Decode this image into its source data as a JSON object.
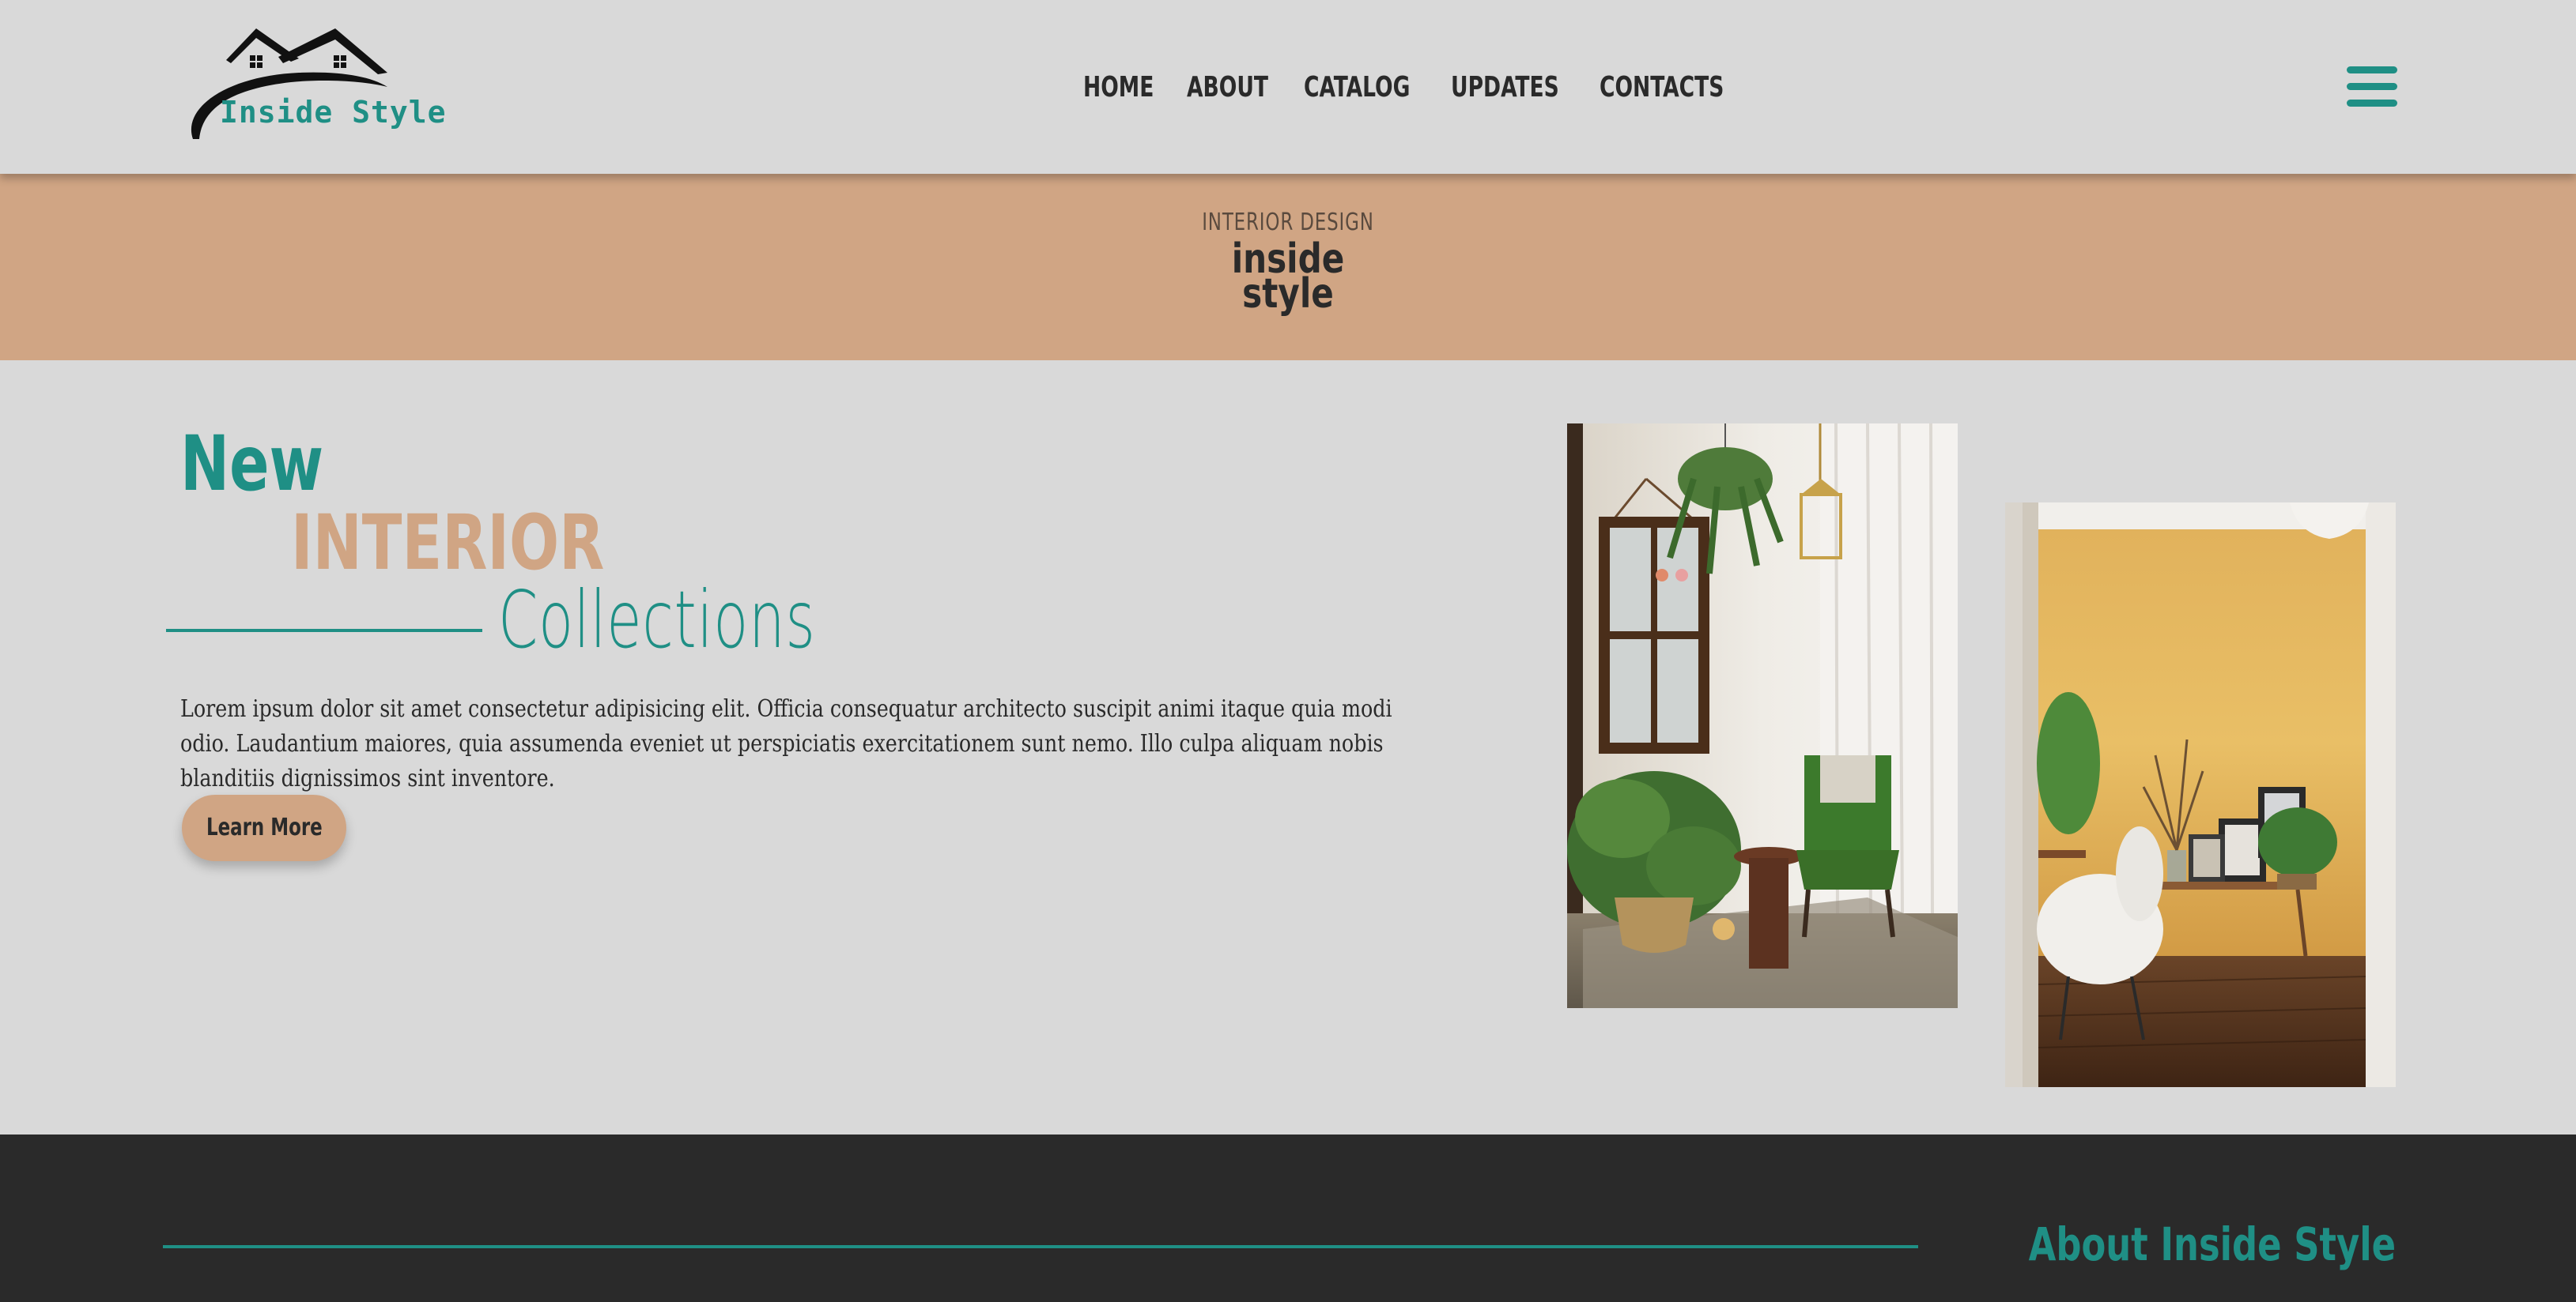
{
  "header": {
    "logo_text": "Inside Style",
    "nav": [
      "HOME",
      "ABOUT",
      "CATALOG",
      "UPDATES",
      "CONTACTS"
    ]
  },
  "banner": {
    "subtitle": "INTERIOR DESIGN",
    "title_line1": "inside",
    "title_line2": "style"
  },
  "hero": {
    "word1": "New",
    "word2": "INTERIOR",
    "word3": "Collections",
    "body": "Lorem ipsum dolor sit amet consectetur adipisicing elit. Officia consequatur architecto suscipit animi itaque quia modi odio. Laudantium maiores, quia assumenda eveniet ut perspiciatis exercitationem sunt nemo. Illo culpa aliquam nobis blanditiis dignissimos sint inventore.",
    "button_label": "Learn More"
  },
  "footer": {
    "title": "About Inside Style"
  },
  "colors": {
    "teal": "#1f8f85",
    "tan": "#d0a584",
    "background": "#d9d9d9",
    "dark": "#2a2a2a"
  }
}
